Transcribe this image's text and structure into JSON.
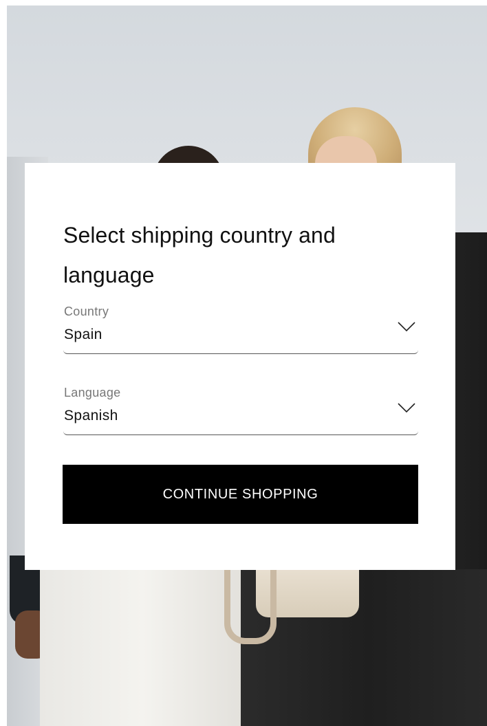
{
  "modal": {
    "title": "Select shipping country and language",
    "country": {
      "label": "Country",
      "value": "Spain",
      "icon": "chevron-down-icon"
    },
    "language": {
      "label": "Language",
      "value": "Spanish",
      "icon": "chevron-down-icon"
    },
    "continue_label": "CONTINUE SHOPPING"
  },
  "colors": {
    "button_bg": "#000000",
    "button_text": "#ffffff",
    "modal_bg": "#ffffff",
    "label_text": "#777777"
  }
}
